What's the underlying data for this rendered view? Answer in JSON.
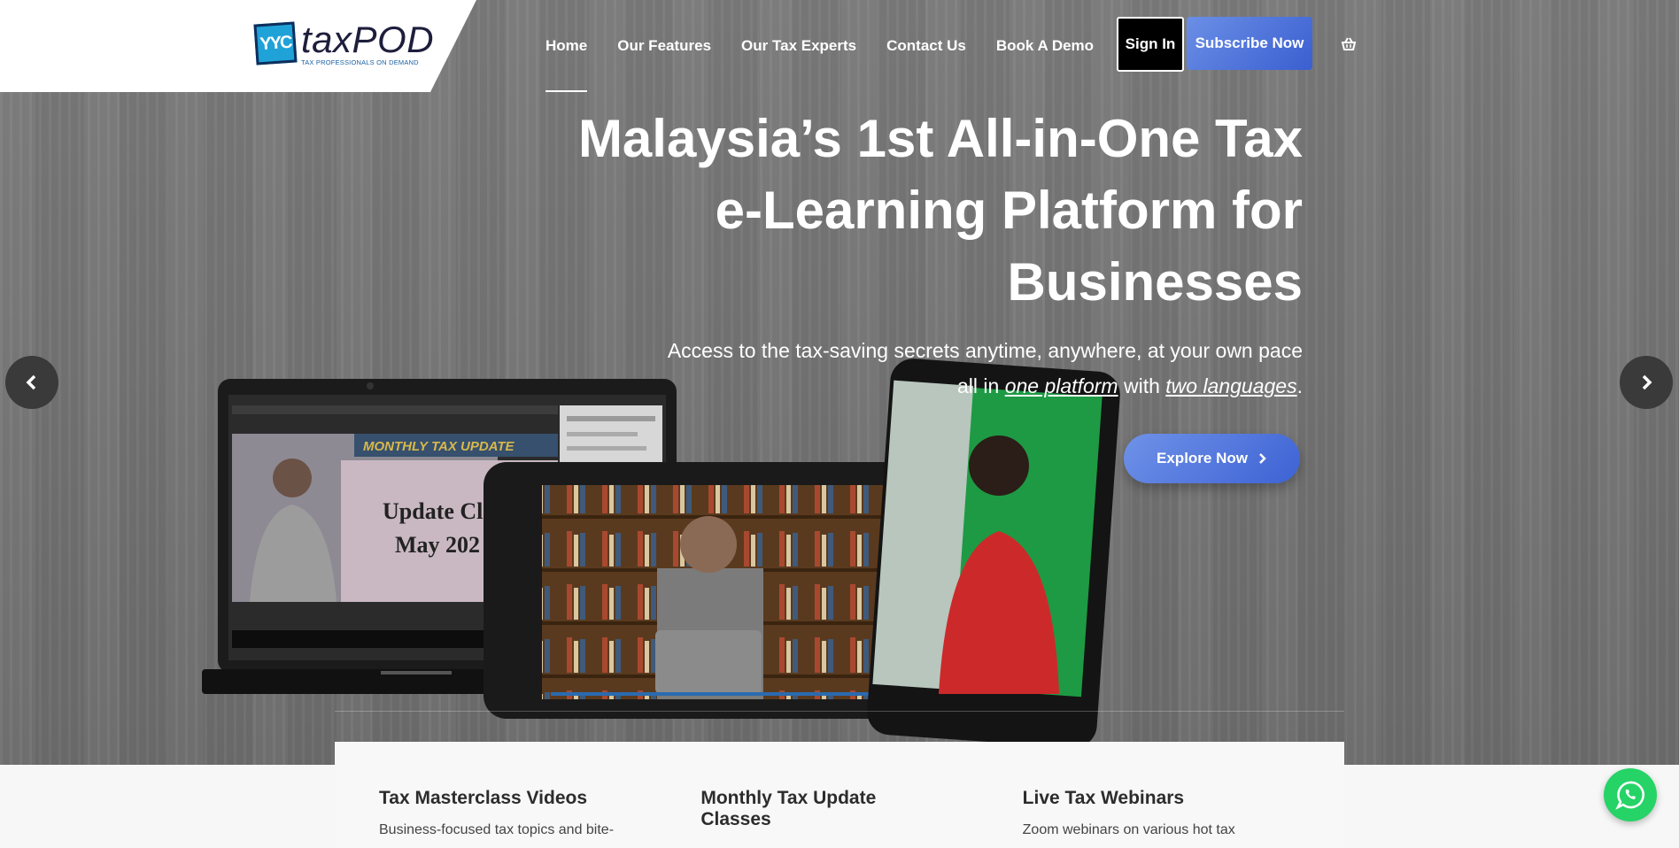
{
  "brand": {
    "logo_mark": "YYC",
    "logo_word": "taxPOD",
    "tagline": "TAX PROFESSIONALS ON DEMAND"
  },
  "nav": {
    "items": [
      {
        "label": "Home",
        "active": true
      },
      {
        "label": "Our Features",
        "active": false
      },
      {
        "label": "Our Tax Experts",
        "active": false
      },
      {
        "label": "Contact Us",
        "active": false
      },
      {
        "label": "Book A Demo",
        "active": false
      }
    ],
    "signin_label": "Sign In",
    "subscribe_label": "Subscribe Now",
    "cart_icon": "cart-icon"
  },
  "hero": {
    "title_line1": "Malaysia’s 1st All-in-One Tax",
    "title_line2": "e-Learning Platform for",
    "title_line3": "Businesses",
    "subtitle_part1": "Access to the tax-saving secrets anytime, anywhere, at your own pace all in ",
    "subtitle_em1": "one platform",
    "subtitle_part2": " with ",
    "subtitle_em2": "two languages",
    "subtitle_part3": ".",
    "cta_label": "Explore Now",
    "laptop_screen_banner": "MONTHLY TAX UPDATE",
    "laptop_screen_line1": "Update Cl",
    "laptop_screen_line2": "May 202"
  },
  "features": [
    {
      "title": "Tax Masterclass Videos",
      "desc": "Business-focused tax topics and bite-"
    },
    {
      "title": "Monthly Tax Update Classes",
      "desc": ""
    },
    {
      "title": "Live Tax Webinars",
      "desc": "Zoom webinars on various hot tax"
    }
  ],
  "colors": {
    "accent_blue": "#4a6fdc",
    "whatsapp_green": "#25d366",
    "hero_overlay": "#777777"
  }
}
